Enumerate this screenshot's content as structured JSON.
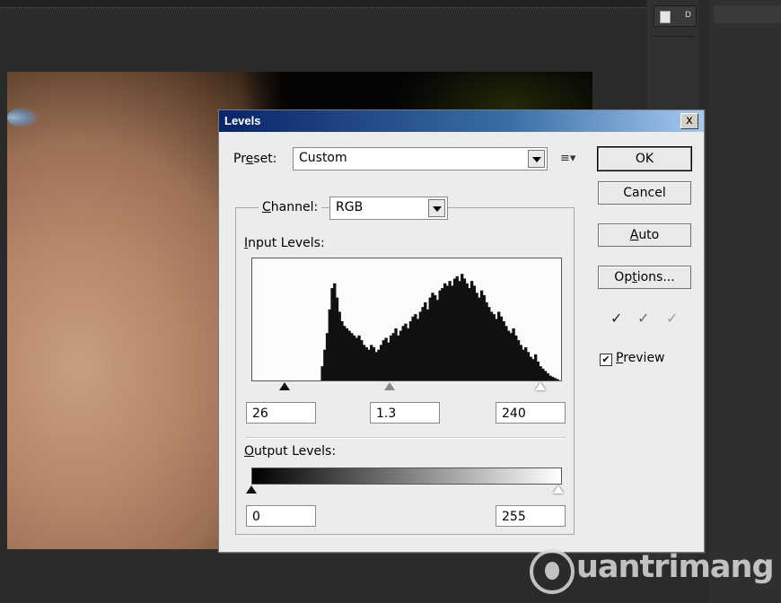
{
  "window": {
    "title": "Levels",
    "close_label": "x"
  },
  "preset": {
    "label_pre": "Pr",
    "label_mn": "e",
    "label_post": "set:",
    "value": "Custom"
  },
  "channel": {
    "label_mn": "C",
    "label_post": "hannel:",
    "value": "RGB"
  },
  "input_levels": {
    "label_mn": "I",
    "label_post": "nput Levels:",
    "black": "26",
    "gamma": "1.3",
    "white": "240"
  },
  "output_levels": {
    "label_mn": "O",
    "label_post": "utput Levels:",
    "black": "0",
    "white": "255"
  },
  "buttons": {
    "ok": "OK",
    "cancel": "Cancel",
    "auto_mn": "A",
    "auto_post": "uto",
    "options_pre": "Op",
    "options_mn": "t",
    "options_post": "ions..."
  },
  "preview": {
    "checked": true,
    "check_mark": "✔",
    "label_mn": "P",
    "label_post": "review"
  },
  "eyedroppers": [
    "black-point-eyedropper-icon",
    "gray-point-eyedropper-icon",
    "white-point-eyedropper-icon"
  ],
  "panel": {
    "tab_letter": "D"
  },
  "watermark": {
    "text": "uantrimang"
  },
  "histogram_bins": [
    0,
    0,
    0,
    0,
    0,
    0,
    0,
    0,
    0,
    0,
    0,
    0,
    0,
    0,
    0,
    0,
    0,
    0,
    0,
    0,
    0,
    0,
    0,
    0,
    0,
    0,
    0,
    0,
    12,
    26,
    40,
    60,
    78,
    82,
    70,
    58,
    50,
    46,
    44,
    42,
    40,
    38,
    36,
    38,
    34,
    30,
    28,
    26,
    30,
    28,
    24,
    26,
    30,
    34,
    36,
    32,
    38,
    40,
    44,
    38,
    42,
    46,
    48,
    44,
    50,
    54,
    56,
    52,
    58,
    62,
    66,
    60,
    70,
    74,
    72,
    68,
    76,
    78,
    82,
    80,
    84,
    80,
    86,
    88,
    84,
    90,
    86,
    82,
    78,
    84,
    80,
    74,
    70,
    76,
    72,
    66,
    62,
    58,
    56,
    52,
    58,
    54,
    50,
    46,
    42,
    40,
    44,
    38,
    34,
    30,
    26,
    28,
    24,
    20,
    18,
    22,
    16,
    12,
    10,
    8,
    6,
    4,
    3,
    2,
    1,
    0
  ],
  "colors": {
    "title_start": "#0a246a",
    "title_end": "#a6caf0",
    "dialog_bg": "#ececec"
  }
}
